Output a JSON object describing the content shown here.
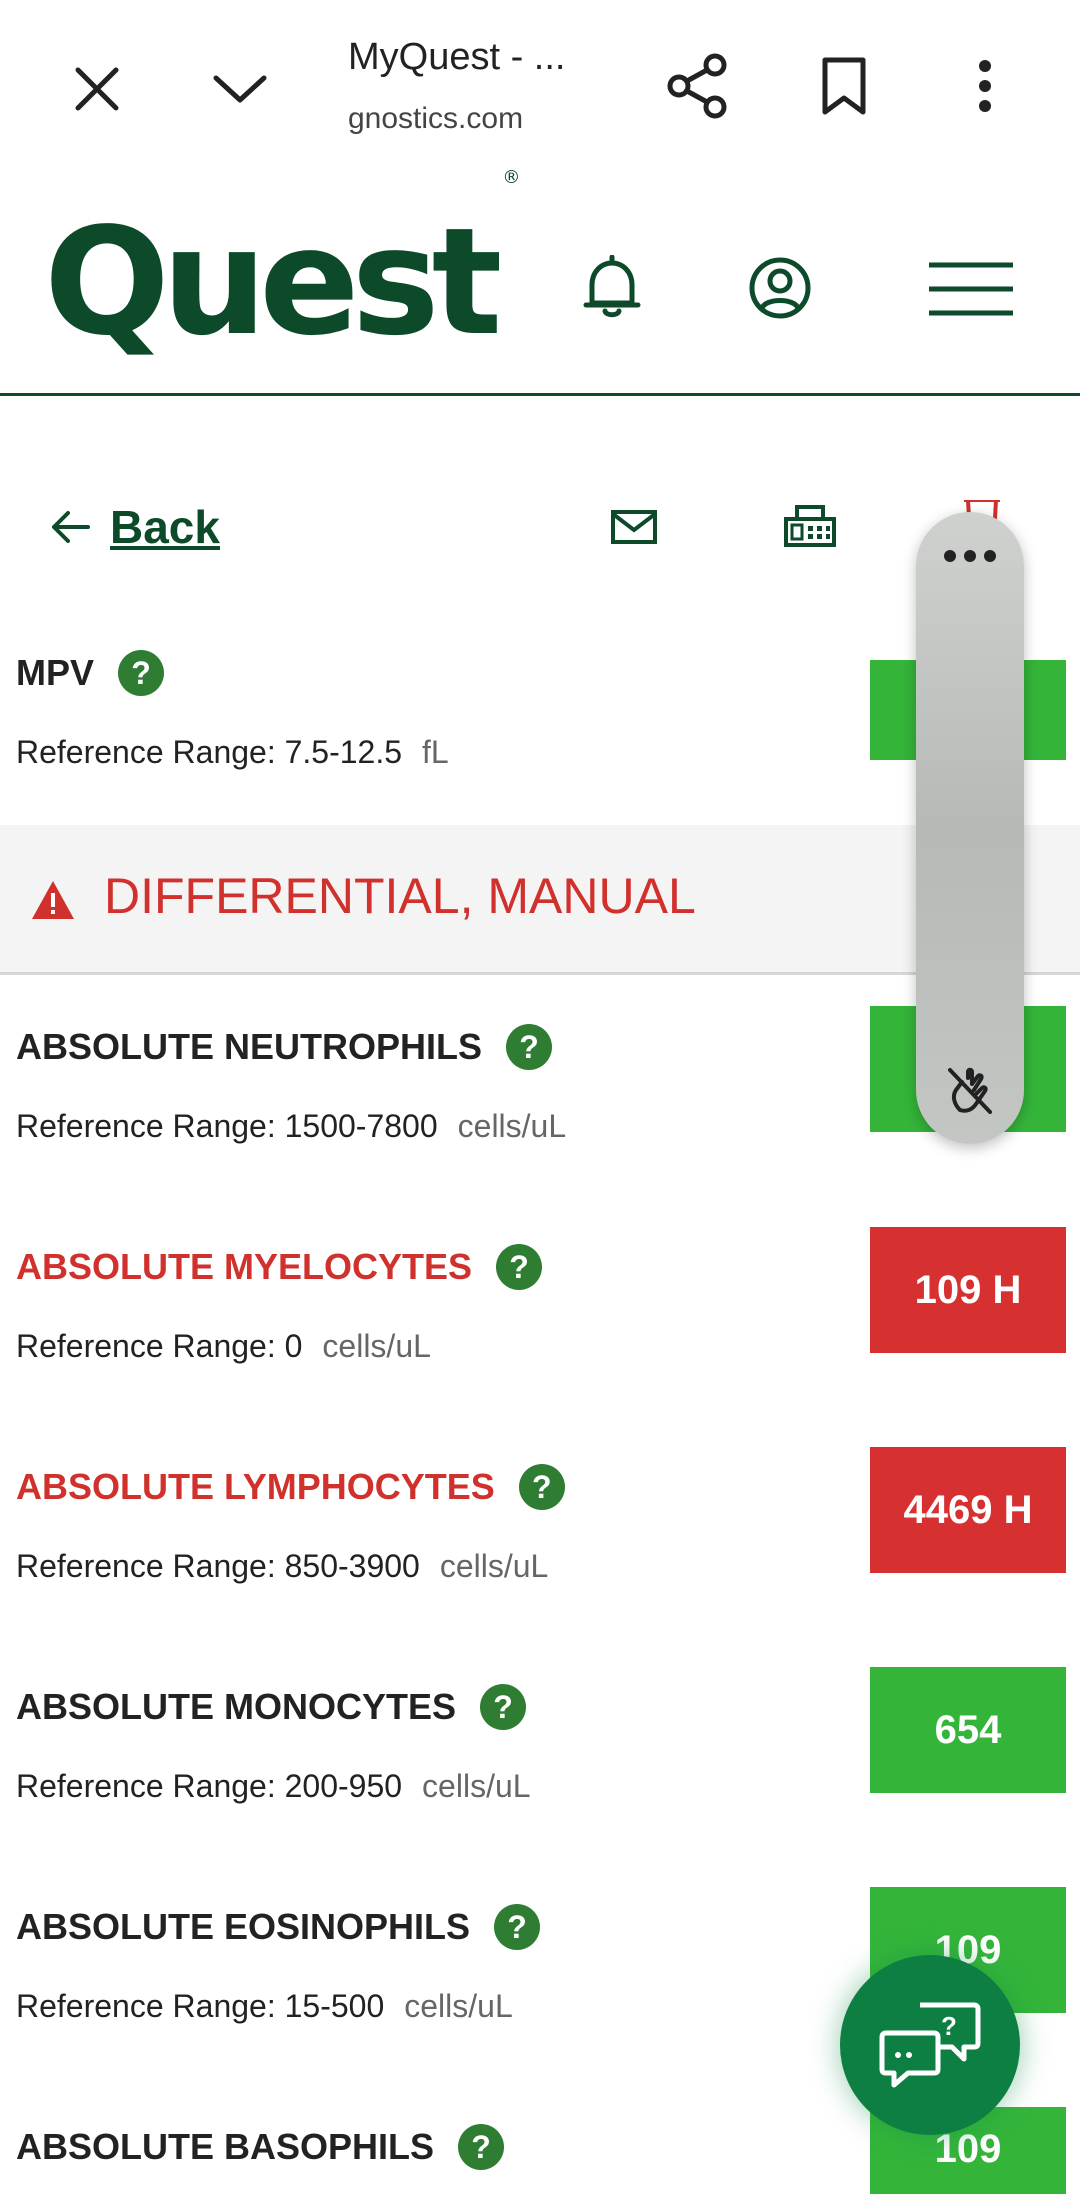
{
  "browser": {
    "title": "MyQuest - ...",
    "url": "gnostics.com"
  },
  "brand": {
    "logo_text": "Quest",
    "registered_mark": "®",
    "color": "#0c4a2a"
  },
  "toolbar": {
    "back_label": "Back",
    "icons": [
      "envelope-icon",
      "fax-icon",
      "trash-icon"
    ]
  },
  "section": {
    "title": "DIFFERENTIAL, MANUAL"
  },
  "colors": {
    "normal": "#34b53a",
    "high": "#d63031",
    "accent": "#2e7d32"
  },
  "results": [
    {
      "name": "MPV",
      "range": "Reference Range: 7.5-12.5",
      "unit": "fL",
      "value": "",
      "status": "normal"
    },
    {
      "name": "ABSOLUTE NEUTROPHILS",
      "range": "Reference Range: 1500-7800",
      "unit": "cells/uL",
      "value": "",
      "status": "normal"
    },
    {
      "name": "ABSOLUTE MYELOCYTES",
      "range": "Reference Range: 0",
      "unit": "cells/uL",
      "value": "109 H",
      "status": "high"
    },
    {
      "name": "ABSOLUTE LYMPHOCYTES",
      "range": "Reference Range: 850-3900",
      "unit": "cells/uL",
      "value": "4469 H",
      "status": "high"
    },
    {
      "name": "ABSOLUTE MONOCYTES",
      "range": "Reference Range: 200-950",
      "unit": "cells/uL",
      "value": "654",
      "status": "normal"
    },
    {
      "name": "ABSOLUTE EOSINOPHILS",
      "range": "Reference Range: 15-500",
      "unit": "cells/uL",
      "value": "109",
      "status": "normal"
    },
    {
      "name": "ABSOLUTE BASOPHILS",
      "range": "",
      "unit": "",
      "value": "109",
      "status": "normal"
    }
  ],
  "help_glyph": "?"
}
